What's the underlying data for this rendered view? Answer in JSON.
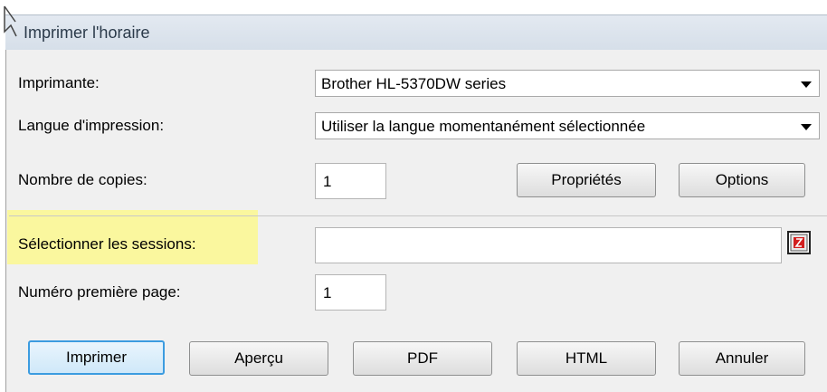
{
  "window": {
    "title": "Imprimer l'horaire"
  },
  "form": {
    "printer": {
      "label": "Imprimante:",
      "value": "Brother HL-5370DW series"
    },
    "language": {
      "label": "Langue d'impression:",
      "value": "Utiliser la langue momentanément sélectionnée"
    },
    "copies": {
      "label": "Nombre de copies:",
      "value": "1"
    },
    "sessions": {
      "label": "Sélectionner les sessions:",
      "value": ""
    },
    "first_page": {
      "label": "Numéro première page:",
      "value": "1"
    }
  },
  "buttons": {
    "properties": "Propriétés",
    "options": "Options",
    "print": "Imprimer",
    "preview": "Aperçu",
    "pdf": "PDF",
    "html": "HTML",
    "cancel": "Annuler"
  },
  "icons": {
    "cursor": "arrow-cursor-icon",
    "session_picker": "session-picker-icon"
  },
  "colors": {
    "highlight": "#faf79e",
    "default_button_border": "#3c9ce0",
    "picker_icon": "#d21f1f"
  }
}
